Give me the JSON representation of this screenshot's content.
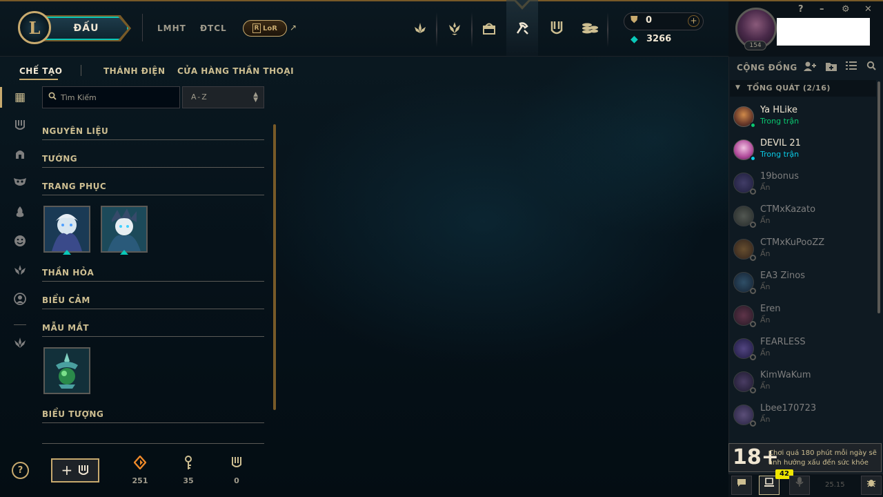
{
  "header": {
    "logo_letter": "L",
    "play_label": "ĐẤU",
    "nav_links": [
      "LMHT",
      "ĐTCL"
    ],
    "lor_label": "LoR",
    "lor_letter": "R",
    "external_icon": "arrow-up-right-icon",
    "nav_icons": [
      "home-icon",
      "tft-icon",
      "loot-icon",
      "collection-icon",
      "honor-icon",
      "store-icon"
    ],
    "active_nav": "collection-icon",
    "rp_value": "0",
    "be_value": "3266",
    "level": "154",
    "window_controls": [
      "?",
      "–",
      "⚙",
      "✕"
    ]
  },
  "subnav": {
    "items": [
      "CHẾ TẠO",
      "THÁNH ĐIỆN",
      "CỬA HÀNG THẦN THOẠI"
    ],
    "active": "CHẾ TẠO"
  },
  "rail": {
    "icons": [
      "grid-icon",
      "chest-icon",
      "helmet-icon",
      "mask-icon",
      "flame-icon",
      "emote-icon",
      "ward-icon",
      "profile-icon",
      "lotus-icon"
    ]
  },
  "search": {
    "placeholder": "Tìm Kiếm",
    "value": ""
  },
  "sort": {
    "value": "A-Z"
  },
  "collection": {
    "sections": [
      {
        "title": "NGUYÊN LIỆU",
        "items": []
      },
      {
        "title": "TƯỚNG",
        "items": []
      },
      {
        "title": "TRANG PHỤC",
        "items": [
          "skin-1",
          "skin-2"
        ]
      },
      {
        "title": "THẦN HỎA",
        "items": []
      },
      {
        "title": "BIỂU CẢM",
        "items": []
      },
      {
        "title": "MẪU MẮT",
        "items": [
          "ward-1"
        ]
      },
      {
        "title": "BIỂU TƯỢNG",
        "items": []
      }
    ]
  },
  "footer": {
    "help_label": "?",
    "craft_label": "+",
    "resources": [
      {
        "icon": "orange-essence-icon",
        "value": "251"
      },
      {
        "icon": "key-icon",
        "value": "35"
      },
      {
        "icon": "chest-icon",
        "value": "0"
      }
    ]
  },
  "social": {
    "title": "CỘNG ĐỒNG",
    "icons": [
      "add-friend-icon",
      "add-folder-icon",
      "list-icon",
      "search-icon"
    ],
    "group": "TỔNG QUÁT (2/16)",
    "friends": [
      {
        "name": "Ya HLike",
        "status": "Trong trận",
        "online": true
      },
      {
        "name": "DEVIL 21",
        "status": "Trong trận",
        "online": true
      },
      {
        "name": "19bonus",
        "status": "Ẩn",
        "online": false
      },
      {
        "name": "CTMxKazato",
        "status": "Ẩn",
        "online": false
      },
      {
        "name": "CTMxKuPooZZ",
        "status": "Ẩn",
        "online": false
      },
      {
        "name": "EA3 Zinos",
        "status": "Ẩn",
        "online": false
      },
      {
        "name": "Eren",
        "status": "Ẩn",
        "online": false
      },
      {
        "name": "FEARLESS",
        "status": "Ẩn",
        "online": false
      },
      {
        "name": "KimWaKum",
        "status": "Ẩn",
        "online": false
      },
      {
        "name": "Lbee170723",
        "status": "Ẩn",
        "online": false
      }
    ],
    "age_rating": "18+",
    "age_warning": "Chơi quá 180 phút mỗi ngày sẽ ảnh hưởng xấu đến sức khỏe",
    "chat_badge": "42",
    "version": "25.15"
  }
}
